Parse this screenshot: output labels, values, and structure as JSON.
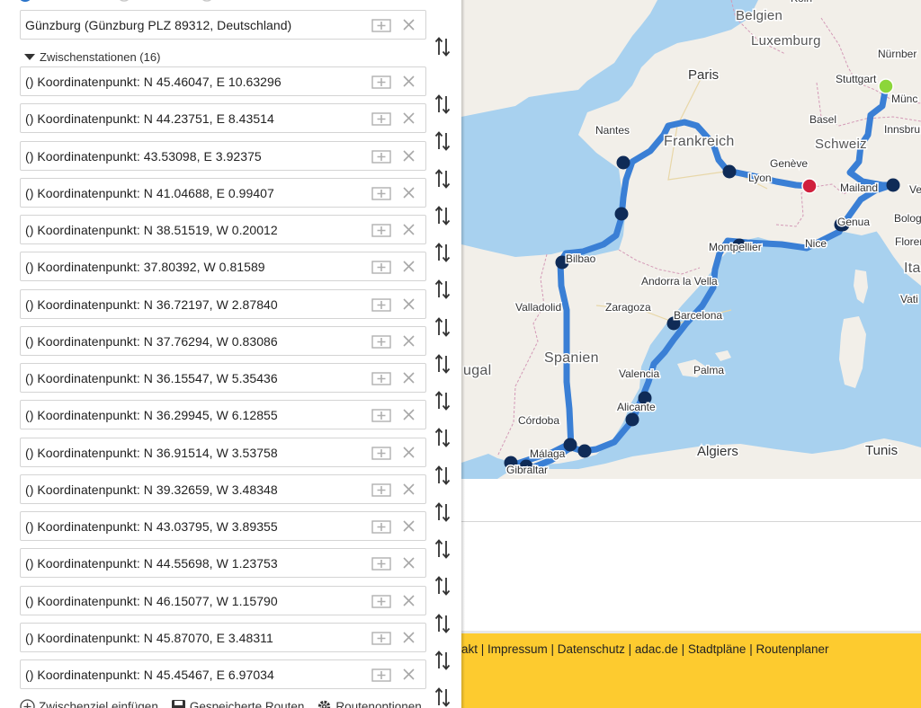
{
  "route": {
    "start": {
      "value": "Günzburg (Günzburg PLZ 89312, Deutschland)"
    },
    "stops_header": "Zwischenstationen (16)",
    "stops": [
      "() Koordinatenpunkt: N 45.46047, E 10.63296",
      "() Koordinatenpunkt: N 44.23751, E 8.43514",
      "() Koordinatenpunkt: 43.53098, E 3.92375",
      "() Koordinatenpunkt: N 41.04688, E 0.99407",
      "() Koordinatenpunkt: N 38.51519, W 0.20012",
      "() Koordinatenpunkt: 37.80392, W 0.81589",
      "() Koordinatenpunkt: N 36.72197, W 2.87840",
      "() Koordinatenpunkt: N 37.76294, W 0.83086",
      "() Koordinatenpunkt: N 36.15547, W 5.35436",
      "() Koordinatenpunkt: N 36.29945, W 6.12855",
      "() Koordinatenpunkt: N 36.91514, W 3.53758",
      "() Koordinatenpunkt: N 39.32659, W 3.48348",
      "() Koordinatenpunkt: N 43.03795, W 3.89355",
      "() Koordinatenpunkt: N 44.55698, W 1.23753",
      "() Koordinatenpunkt: N 46.15077, W 1.15790",
      "() Koordinatenpunkt: N 45.87070, E 3.48311",
      "() Koordinatenpunkt: N 45.45467, E 6.97034"
    ],
    "actions": {
      "add_stop": "Zwischenziel einfügen",
      "saved_routes": "Gespeicherte Routen",
      "route_options": "Routenoptionen"
    }
  },
  "map": {
    "labels": {
      "koln": "Köln",
      "belgien": "Belgien",
      "luxemburg": "Luxemburg",
      "nurnberg": "Nürnber",
      "paris": "Paris",
      "stuttgart": "Stuttgart",
      "munchen": "Münc",
      "basel": "Basel",
      "innsbruck": "Innsbru",
      "nantes": "Nantes",
      "frankreich": "Frankreich",
      "schweiz": "Schweiz",
      "geneve": "Genève",
      "lyon": "Lyon",
      "mailand": "Mailand",
      "ve": "Ve",
      "genua": "Genua",
      "bologna": "Bologr",
      "florenz": "Floren",
      "bilbao": "Bilbao",
      "montpellier": "Montpellier",
      "nice": "Nice",
      "ita": "Ita",
      "andorra": "Andorra la Vella",
      "valladolid": "Valladolid",
      "zaragoza": "Zaragoza",
      "vati": "Vati",
      "barcelona": "Barcelona",
      "spanien": "Spanien",
      "ugal": "ugal",
      "valencia": "Valencia",
      "palma": "Palma",
      "alicante": "Alicante",
      "cordoba": "Córdoba",
      "malaga": "Málaga",
      "algiers": "Algiers",
      "tunis": "Tunis",
      "gibraltar": "Gibraltar"
    },
    "colors": {
      "route": "#3a7fd5",
      "waypoint": "#0f2b57",
      "start_marker": "#8cd63a",
      "end_marker": "#d01f3c",
      "land": "#f2efe9",
      "water": "#a8d1ef"
    }
  },
  "footer": {
    "links": "akt | Impressum | Datenschutz | adac.de | Stadtpläne | Routenplaner"
  }
}
